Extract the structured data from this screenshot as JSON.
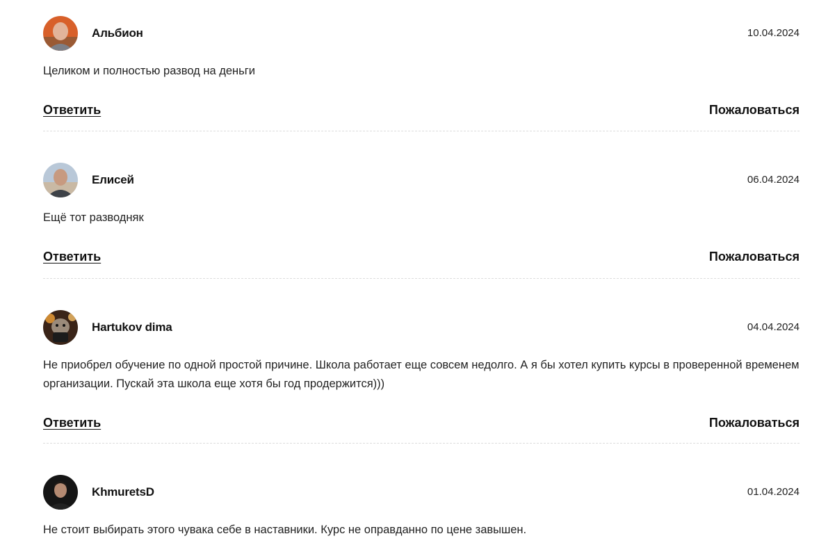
{
  "actions": {
    "reply_label": "Ответить",
    "report_label": "Пожаловаться"
  },
  "comments": [
    {
      "author": "Альбион",
      "date": "10.04.2024",
      "text": "Целиком и полностью развод на деньги",
      "avatar": "avatar-photo-man-orange-background"
    },
    {
      "author": "Елисей",
      "date": "06.04.2024",
      "text": "Ещё тот разводняк",
      "avatar": "avatar-photo-man-outdoor"
    },
    {
      "author": "Hartukov dima",
      "date": "04.04.2024",
      "text": "Не приобрел обучение по одной простой причине. Школа работает еще совсем недолго. А я бы хотел купить курсы в проверенной временем организации. Пускай эта школа еще хотя бы год продержится)))",
      "avatar": "avatar-illustration-hamster"
    },
    {
      "author": "KhmuretsD",
      "date": "01.04.2024",
      "text": "Не стоит выбирать этого чувака себе в наставники. Курс не оправданно по цене завышен.",
      "avatar": "avatar-photo-man-dark-background"
    }
  ]
}
